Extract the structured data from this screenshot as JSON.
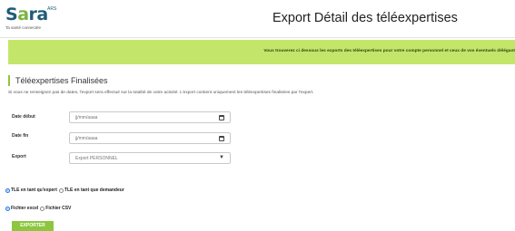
{
  "app": {
    "logo_prefix": "S",
    "logo_o": "a",
    "logo_suffix": "ra",
    "logo_badge": "ARS",
    "logo_tagline": "Ta santé connectée",
    "page_title": "Export Détail des téléexpertises"
  },
  "banner": {
    "text": "Vous trouverez ci dessous les exports des téléexpertises pour votre compte personnel et ceux de vos éventuels délégant"
  },
  "section": {
    "title": "Téléexpertises Finalisées",
    "note": "Si vous ne renseignez pas de dates, l'export sera effectué sur la totalité de votre activité. L'export contient uniquement les téléexpertises finalisées par l'expert."
  },
  "form": {
    "date_start_label": "Date début",
    "date_start_placeholder": "jj/mm/aaaa",
    "date_end_label": "Date fin",
    "date_end_placeholder": "jj/mm/aaaa",
    "export_label": "Export",
    "export_selected": "Export PERSONNEL"
  },
  "role_options": {
    "expert_label": "TLE en tant qu'expert",
    "demandeur_label": "TLE en tant que demandeur",
    "selected": "expert"
  },
  "format_options": {
    "excel_label": "Fichier excel",
    "csv_label": "Fichier CSV",
    "selected": "excel"
  },
  "actions": {
    "export_button": "EXPORTER"
  },
  "colors": {
    "accent": "#8dc63f",
    "banner": "#c3e66a",
    "brand": "#1f5b78"
  }
}
